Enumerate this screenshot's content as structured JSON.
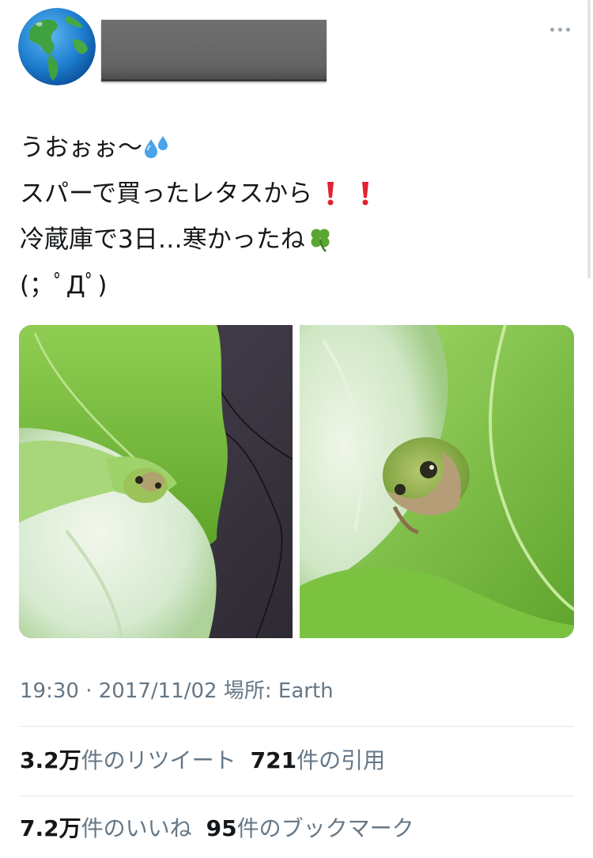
{
  "header": {
    "avatar_icon": "earth-globe-icon",
    "name_redacted": true,
    "more_icon": "more-horizontal-icon"
  },
  "tweet": {
    "lines": [
      {
        "text": "うおぉぉ〜",
        "emoji": "sweat-droplets-icon"
      },
      {
        "text": "スパーで買ったレタスから",
        "emoji": "exclamation-icon"
      },
      {
        "text": "冷蔵庫で3日…寒かったね",
        "emoji": "four-leaf-clover-icon"
      },
      {
        "text": "(；ﾟДﾟ)",
        "emoji": ""
      }
    ]
  },
  "media": {
    "photos": [
      {
        "subject": "frog-in-lettuce-photo"
      },
      {
        "subject": "frog-in-lettuce-closeup-photo"
      }
    ]
  },
  "meta": {
    "time": "19:30",
    "separator": "·",
    "date": "2017/11/02",
    "location_label": "場所:",
    "location": "Earth"
  },
  "stats": {
    "retweets_value": "3.2万",
    "retweets_label": "件のリツイート",
    "quotes_value": "721",
    "quotes_label": "件の引用",
    "likes_value": "7.2万",
    "likes_label": "件のいいね",
    "bookmarks_value": "95",
    "bookmarks_label": "件のブックマーク"
  },
  "colors": {
    "text": "#14171a",
    "secondary_text": "#657786",
    "divider": "#e1e8ed",
    "exclamation_red": "#e0222f",
    "clover_green": "#5aa632",
    "droplet_blue": "#4aa3e8"
  }
}
